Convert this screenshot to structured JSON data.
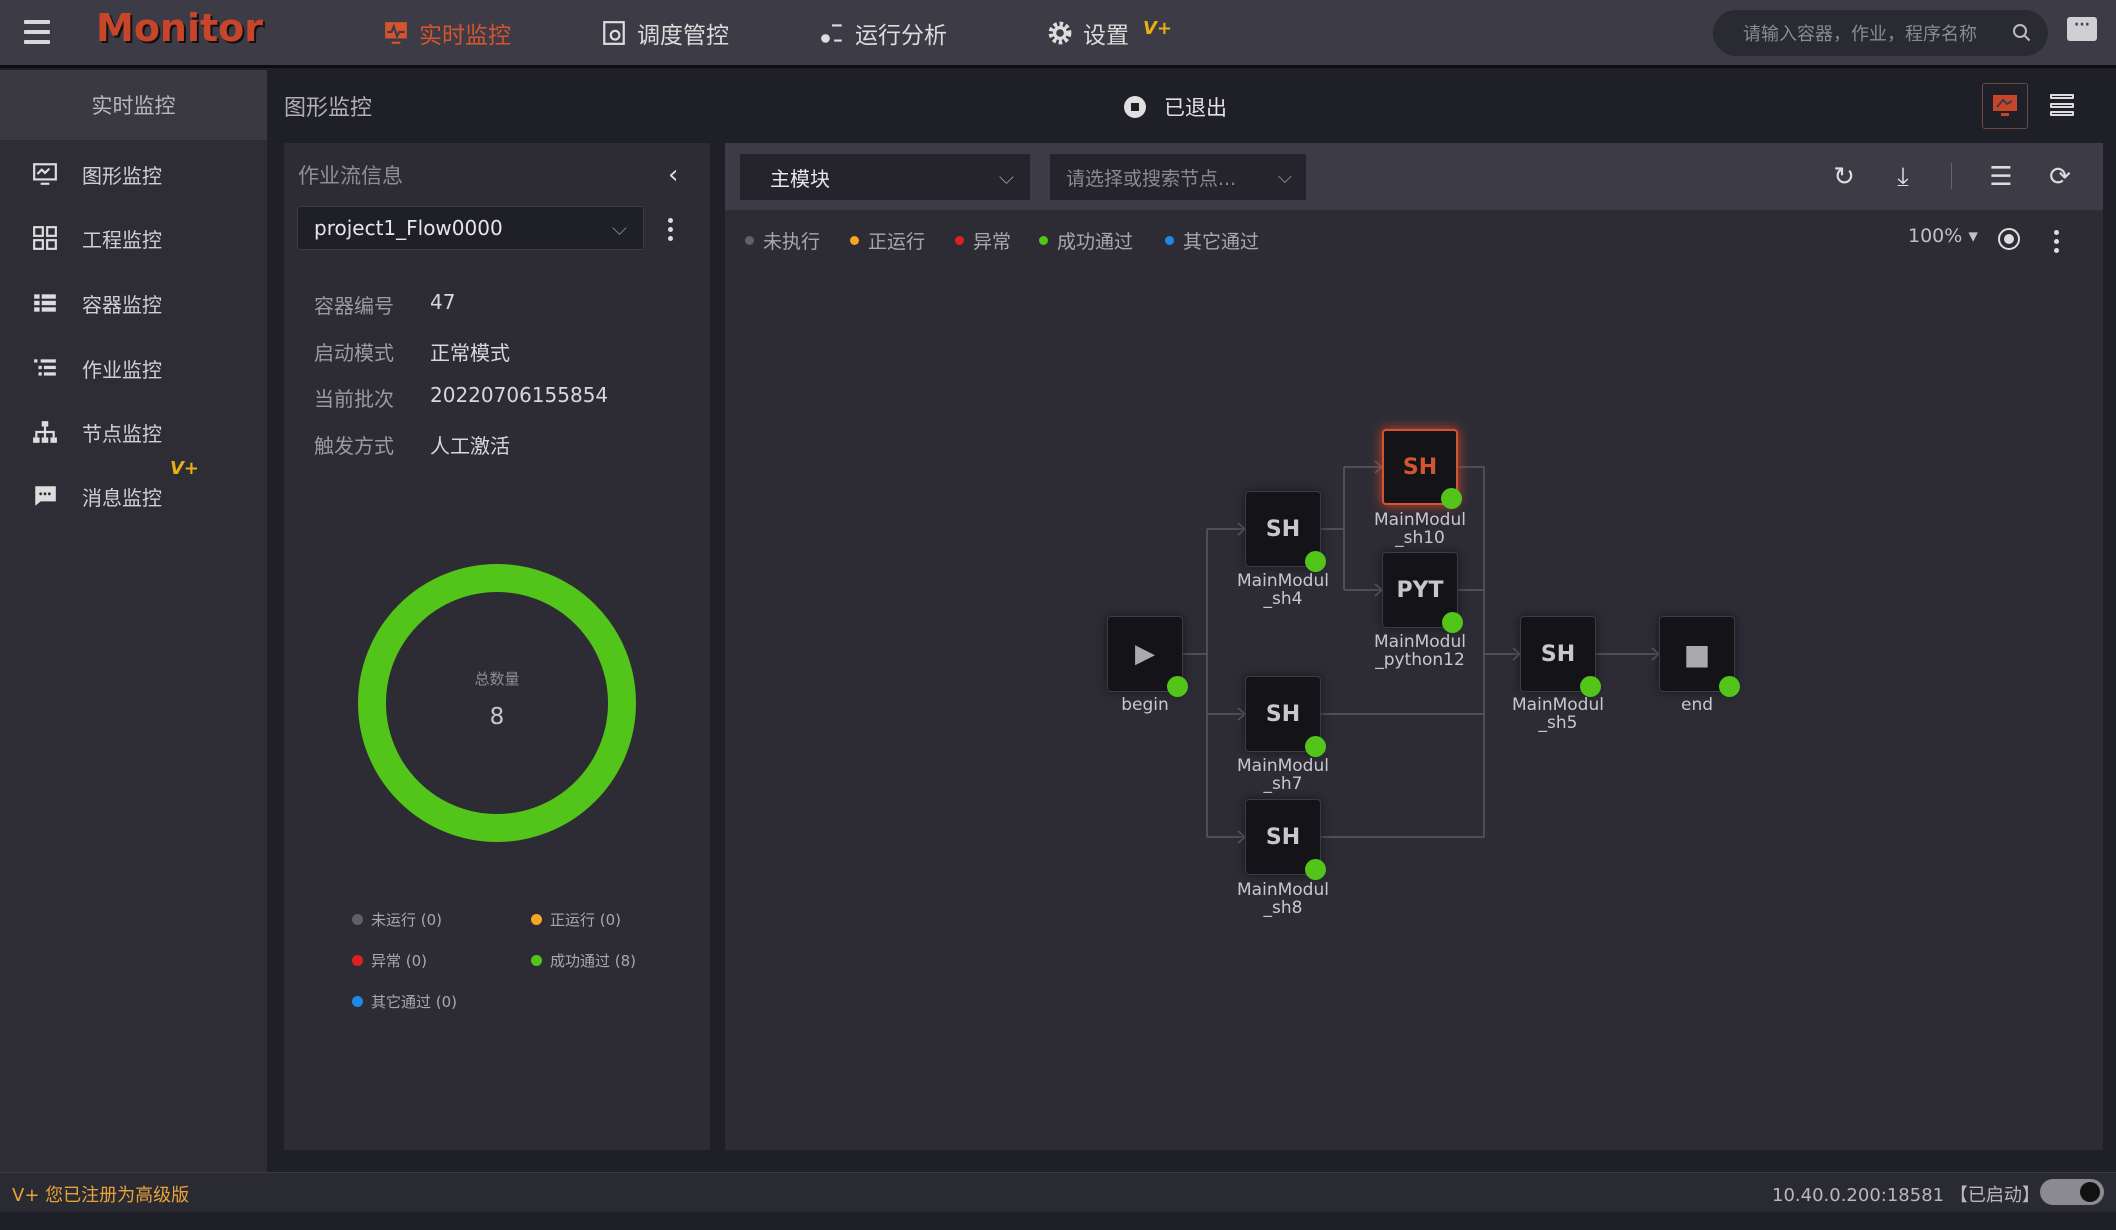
{
  "header": {
    "logo": "Monitor",
    "nav": [
      {
        "label": "实时监控",
        "active": true
      },
      {
        "label": "调度管控"
      },
      {
        "label": "运行分析"
      },
      {
        "label": "设置",
        "badge": "V+"
      }
    ],
    "search_placeholder": "请输入容器，作业，程序名称"
  },
  "sidebar": {
    "title": "实时监控",
    "items": [
      {
        "label": "图形监控"
      },
      {
        "label": "工程监控"
      },
      {
        "label": "容器监控"
      },
      {
        "label": "作业监控"
      },
      {
        "label": "节点监控"
      },
      {
        "label": "消息监控",
        "badge": "V+"
      }
    ]
  },
  "page": {
    "breadcrumb": "图形监控",
    "status": "已退出"
  },
  "info": {
    "title": "作业流信息",
    "flow": "project1_Flow0000",
    "fields": [
      {
        "k": "容器编号",
        "v": "47"
      },
      {
        "k": "启动模式",
        "v": "正常模式"
      },
      {
        "k": "当前批次",
        "v": "20220706155854"
      },
      {
        "k": "触发方式",
        "v": "人工激活"
      }
    ],
    "donut": {
      "label": "总数量",
      "total": "8"
    },
    "legend": [
      {
        "label": "未运行 (0)",
        "color": "#606066"
      },
      {
        "label": "正运行 (0)",
        "color": "#f5a623"
      },
      {
        "label": "异常 (0)",
        "color": "#e02020"
      },
      {
        "label": "成功通过 (8)",
        "color": "#52c41a"
      },
      {
        "label": "其它通过 (0)",
        "color": "#1e88e5"
      }
    ]
  },
  "graph": {
    "module": "主模块",
    "node_placeholder": "请选择或搜索节点...",
    "zoom": "100%",
    "legend": [
      {
        "label": "未执行",
        "color": "#606066"
      },
      {
        "label": "正运行",
        "color": "#f5a623"
      },
      {
        "label": "异常",
        "color": "#e02020"
      },
      {
        "label": "成功通过",
        "color": "#52c41a"
      },
      {
        "label": "其它通过",
        "color": "#1e88e5"
      }
    ],
    "nodes": [
      {
        "type": "▶",
        "l1": "begin",
        "l2": ""
      },
      {
        "type": "SH",
        "l1": "MainModul",
        "l2": "_sh4"
      },
      {
        "type": "SH",
        "l1": "MainModul",
        "l2": "_sh10"
      },
      {
        "type": "PYT",
        "l1": "MainModul",
        "l2": "_python12"
      },
      {
        "type": "SH",
        "l1": "MainModul",
        "l2": "_sh7"
      },
      {
        "type": "SH",
        "l1": "MainModul",
        "l2": "_sh8"
      },
      {
        "type": "SH",
        "l1": "MainModul",
        "l2": "_sh5"
      },
      {
        "type": "■",
        "l1": "end",
        "l2": ""
      }
    ]
  },
  "footer": {
    "registration": "V+ 您已注册为高级版",
    "address": "10.40.0.200:18581 【已启动】"
  }
}
